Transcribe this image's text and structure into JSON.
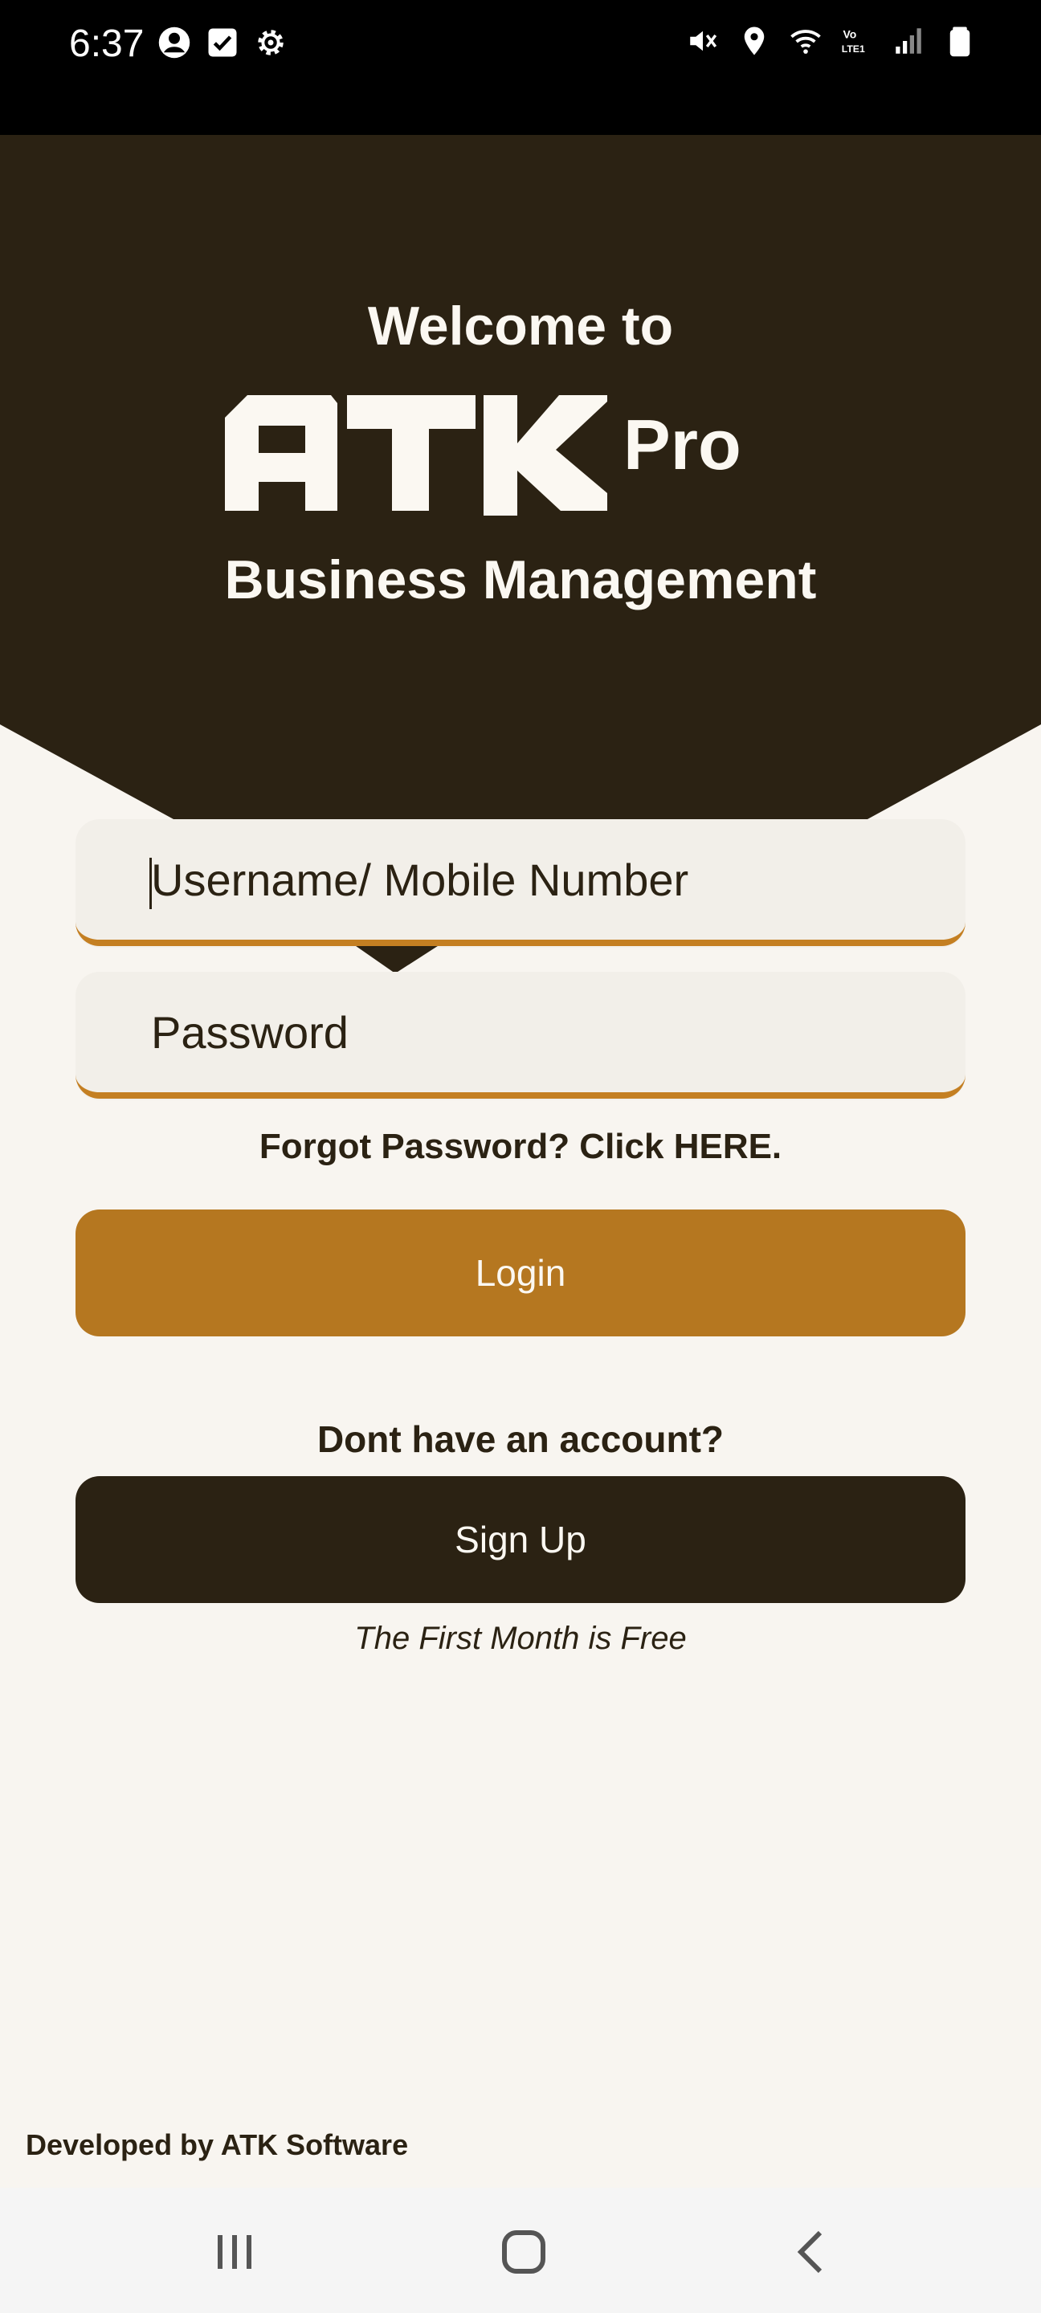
{
  "status_bar": {
    "time": "6:37",
    "left_icons": [
      "account-circle-icon",
      "checkbox-icon",
      "settings-gear-icon"
    ],
    "right_icons": [
      "mute-icon",
      "location-pin-icon",
      "wifi-icon",
      "volte-icon",
      "signal-icon",
      "battery-icon"
    ],
    "volte_label": "Vo LTE1"
  },
  "header": {
    "welcome": "Welcome to",
    "logo_text": "ATK",
    "logo_suffix": "Pro",
    "subtitle": "Business Management"
  },
  "form": {
    "username_placeholder": "Username/ Mobile Number",
    "password_placeholder": "Password",
    "forgot_text": "Forgot Password? Click HERE.",
    "login_label": "Login",
    "no_account_text": "Dont have an account?",
    "signup_label": "Sign Up",
    "free_text": "The First Month is Free"
  },
  "footer": {
    "developer": "Developed by ATK Software"
  },
  "nav": {
    "icons": [
      "recents-icon",
      "home-icon",
      "back-icon"
    ]
  },
  "colors": {
    "dark_brown": "#2b2213",
    "accent": "#b57720",
    "background": "#f8f5f0",
    "input_bg": "#f2efe9"
  }
}
